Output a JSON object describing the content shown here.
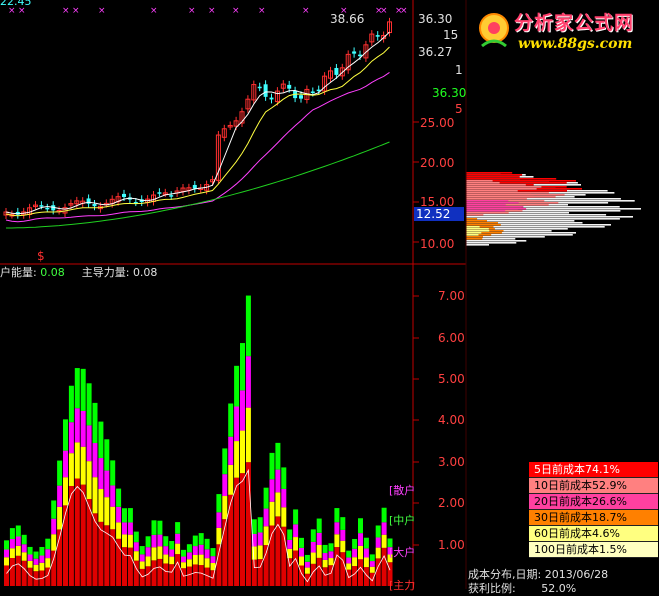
{
  "price_axis": {
    "ticks": [
      "36.30",
      "15",
      "36.27",
      "1",
      "36.30",
      "5",
      "25.00",
      "20.00",
      "15.00",
      "10.00"
    ],
    "current_price": "12.52",
    "top_left_price": "22.45",
    "peak_label": "38.66",
    "signal_mark": "$"
  },
  "volume_axis": {
    "ticks": [
      "7.00",
      "6.00",
      "5.00",
      "4.00",
      "3.00",
      "2.00",
      "1.00"
    ]
  },
  "indicator": {
    "name1": "户能量:",
    "value1": "0.08",
    "name2": "主导力量:",
    "value2": "0.08",
    "labels": [
      "散户",
      "中户",
      "大户",
      "主力"
    ]
  },
  "cost_legend": [
    {
      "text": "5日前成本74.1%",
      "color": "#ff0000",
      "fg": "#ffffff"
    },
    {
      "text": "10日前成本52.9%",
      "color": "#ff8080",
      "fg": "#000000"
    },
    {
      "text": "20日前成本26.6%",
      "color": "#ff40a0",
      "fg": "#000000"
    },
    {
      "text": "30日前成本18.7%",
      "color": "#ff8000",
      "fg": "#000000"
    },
    {
      "text": "60日前成本4.6%",
      "color": "#ffff80",
      "fg": "#000000"
    },
    {
      "text": "100日前成本1.5%",
      "color": "#ffffc0",
      "fg": "#000000"
    }
  ],
  "footer": {
    "line1": "成本分布,日期: 2013/06/28",
    "line2": "获利比例:",
    "profit_value": "52.0%"
  },
  "logo": {
    "title": "分析家公式网",
    "url": "www.88gs.com"
  },
  "colors": {
    "axis_red": "#c00000",
    "tick_red": "#ff4040",
    "candle_up": "#ff3030",
    "candle_down": "#40ffff",
    "ma_white": "#ffffff",
    "ma_yellow": "#ffff40",
    "ma_magenta": "#ff40ff",
    "ma_green": "#20d020",
    "bar_red": "#e00000",
    "bar_yellow": "#ffff00",
    "bar_magenta": "#ff00ff",
    "bar_green": "#00ff00",
    "current_box": "#1030c0"
  }
}
